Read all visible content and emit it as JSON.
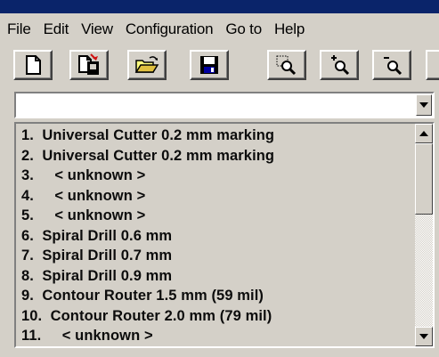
{
  "menu": {
    "items": [
      {
        "label": "File"
      },
      {
        "label": "Edit"
      },
      {
        "label": "View"
      },
      {
        "label": "Configuration"
      },
      {
        "label": "Go to"
      },
      {
        "label": "Help"
      }
    ]
  },
  "toolbar": {
    "buttons": [
      {
        "icon": "new-document-icon"
      },
      {
        "icon": "new-document-with-tool-icon"
      },
      {
        "icon": "open-folder-icon"
      },
      {
        "icon": "save-disk-icon"
      },
      {
        "icon": "zoom-window-icon"
      },
      {
        "icon": "zoom-in-icon"
      },
      {
        "icon": "zoom-out-icon"
      }
    ]
  },
  "combo": {
    "value": ""
  },
  "tool_list": {
    "items": [
      {
        "label": "1.  Universal Cutter 0.2 mm marking"
      },
      {
        "label": "2.  Universal Cutter 0.2 mm marking"
      },
      {
        "label": "3.     < unknown >"
      },
      {
        "label": "4.     < unknown >"
      },
      {
        "label": "5.     < unknown >"
      },
      {
        "label": "6.  Spiral Drill 0.6 mm"
      },
      {
        "label": "7.  Spiral Drill 0.7 mm"
      },
      {
        "label": "8.  Spiral Drill 0.9 mm"
      },
      {
        "label": "9.  Contour Router 1.5 mm (59 mil)"
      },
      {
        "label": "10.  Contour Router 2.0 mm (79 mil)"
      },
      {
        "label": "11.     < unknown >"
      }
    ]
  },
  "colors": {
    "face": "#d4d0c8",
    "title_strip": "#0a246a",
    "accent_red": "#d01010",
    "disk_blue": "#0000a0"
  }
}
